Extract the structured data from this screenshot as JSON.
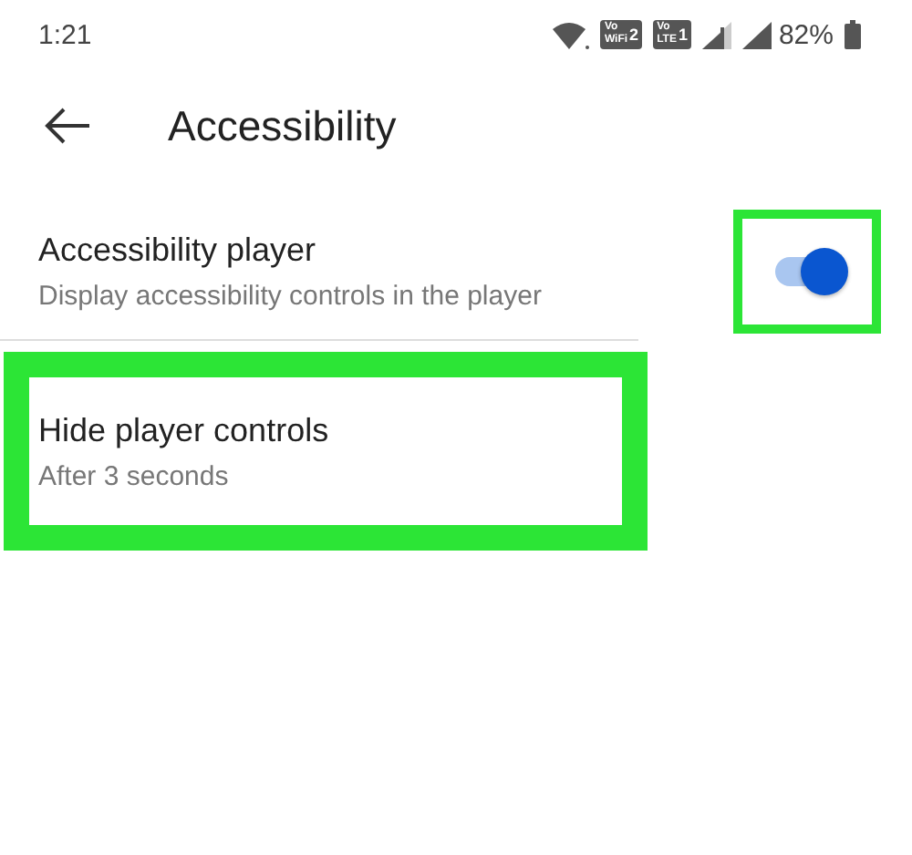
{
  "status_bar": {
    "time": "1:21",
    "badges": [
      {
        "top": "Vo",
        "bottom": "WiFi",
        "number": "2"
      },
      {
        "top": "Vo",
        "bottom": "LTE",
        "number": "1"
      }
    ],
    "battery": "82%"
  },
  "header": {
    "title": "Accessibility"
  },
  "settings": [
    {
      "kind": "switch",
      "title": "Accessibility player",
      "subtitle": "Display accessibility controls in the player",
      "on": true,
      "highlighted": true
    },
    {
      "kind": "plain",
      "title": "Hide player controls",
      "subtitle": "After 3 seconds",
      "highlighted": true
    }
  ]
}
